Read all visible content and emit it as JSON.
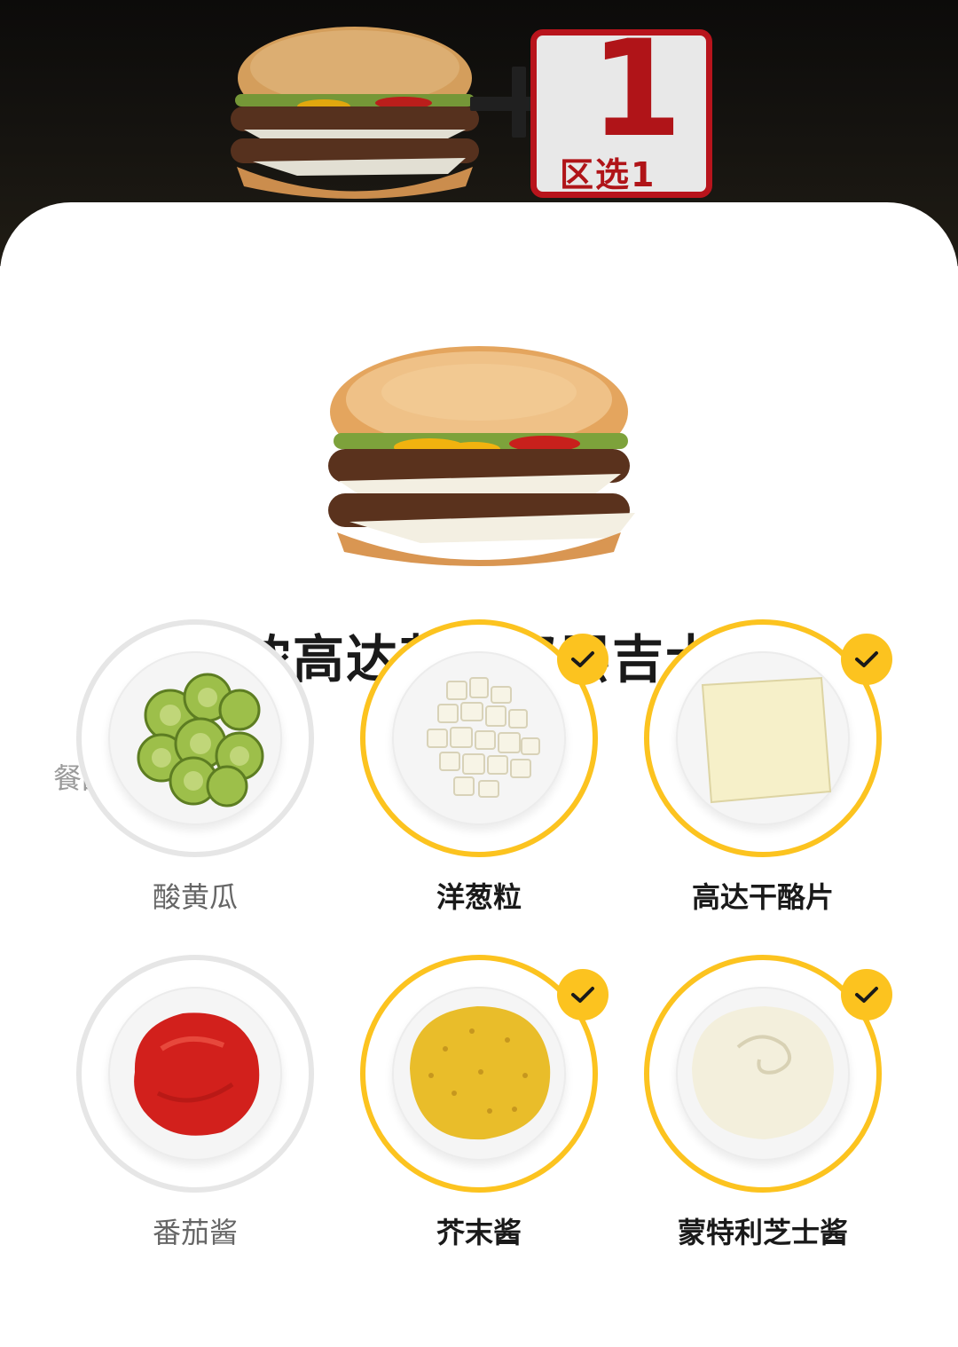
{
  "banner": {
    "promo_number": "1",
    "promo_text": "区选1"
  },
  "product": {
    "title": "浓浓高达芝士双层吉士堡"
  },
  "customization": {
    "section_label": "餐品定制(多选)",
    "options": [
      {
        "label": "酸黄瓜",
        "selected": false,
        "food_icon": "pickle-slices-icon"
      },
      {
        "label": "洋葱粒",
        "selected": true,
        "food_icon": "diced-onion-icon"
      },
      {
        "label": "高达干酪片",
        "selected": true,
        "food_icon": "cheese-slice-icon"
      },
      {
        "label": "番茄酱",
        "selected": false,
        "food_icon": "ketchup-icon"
      },
      {
        "label": "芥末酱",
        "selected": true,
        "food_icon": "mustard-icon"
      },
      {
        "label": "蒙特利芝士酱",
        "selected": true,
        "food_icon": "cheese-sauce-icon"
      }
    ]
  },
  "colors": {
    "accent_yellow": "#fcc31f",
    "promo_red": "#b8141c",
    "unselected_ring": "#e6e6e6"
  }
}
